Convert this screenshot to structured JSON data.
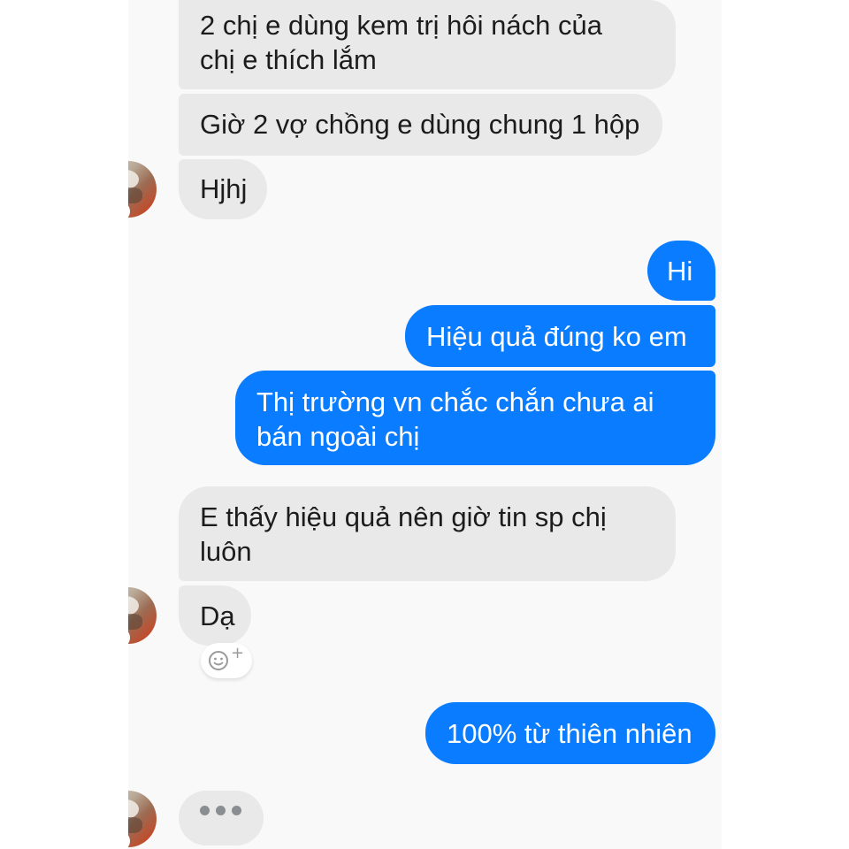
{
  "conversation": {
    "messages": [
      {
        "id": "m1",
        "direction": "incoming",
        "text": "2 chị e dùng kem trị hôi nách của\nchị e thích lắm"
      },
      {
        "id": "m2",
        "direction": "incoming",
        "text": "Giờ 2 vợ chồng e dùng chung 1 hộp"
      },
      {
        "id": "m3",
        "direction": "incoming",
        "text": "Hjhj"
      },
      {
        "id": "m4",
        "direction": "outgoing",
        "text": "Hi"
      },
      {
        "id": "m5",
        "direction": "outgoing",
        "text": "Hiệu quả đúng ko em"
      },
      {
        "id": "m6",
        "direction": "outgoing",
        "text": "Thị  trường vn chắc chắn chưa ai\nbán ngoài chị"
      },
      {
        "id": "m7",
        "direction": "incoming",
        "text": "E thấy hiệu quả nên giờ tin sp chị\nluôn"
      },
      {
        "id": "m8",
        "direction": "incoming",
        "text": "Dạ"
      },
      {
        "id": "m9",
        "direction": "outgoing",
        "text": "100% từ thiên nhiên"
      }
    ],
    "reaction_button": {
      "icon": "add-reaction-icon",
      "plus_glyph": "+"
    },
    "typing_indicator": {
      "icon": "typing-dots-icon"
    }
  },
  "colors": {
    "incoming_bubble": "#e9e9e9",
    "outgoing_bubble": "#0a7cff",
    "online_status": "#42b72a",
    "background": "#f9f9f9"
  }
}
